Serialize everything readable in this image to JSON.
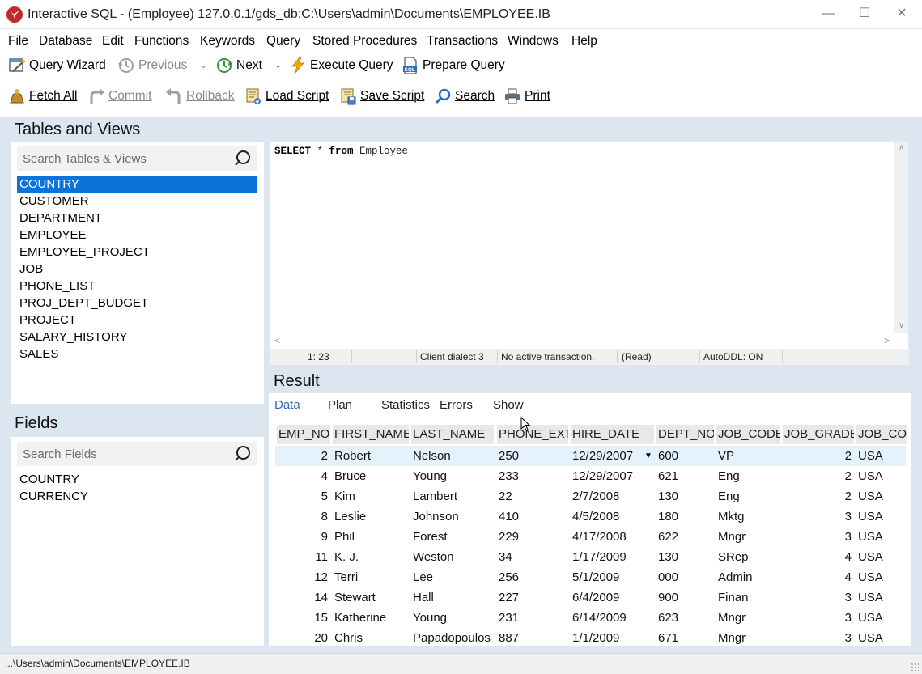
{
  "window": {
    "title": "Interactive SQL - (Employee) 127.0.0.1/gds_db:C:\\Users\\admin\\Documents\\EMPLOYEE.IB",
    "minimize_glyph": "—",
    "maximize_glyph": "☐",
    "close_glyph": "✕"
  },
  "menu": [
    "File",
    "Database",
    "Edit",
    "Functions",
    "Keywords",
    "Query",
    "Stored Procedures",
    "Transactions",
    "Windows",
    "Help"
  ],
  "toolbar1": {
    "query_wizard": "Query Wizard",
    "previous": "Previous",
    "next": "Next",
    "execute_query": "Execute Query",
    "prepare_query": "Prepare Query",
    "dropdown_glyph": "⌄"
  },
  "toolbar2": {
    "fetch_all": "Fetch All",
    "commit": "Commit",
    "rollback": "Rollback",
    "load_script": "Load Script",
    "save_script": "Save Script",
    "search": "Search",
    "print": "Print"
  },
  "tables_views": {
    "title": "Tables and Views",
    "search_placeholder": "Search Tables & Views",
    "items": [
      "COUNTRY",
      "CUSTOMER",
      "DEPARTMENT",
      "EMPLOYEE",
      "EMPLOYEE_PROJECT",
      "JOB",
      "PHONE_LIST",
      "PROJ_DEPT_BUDGET",
      "PROJECT",
      "SALARY_HISTORY",
      "SALES"
    ],
    "selected": "COUNTRY"
  },
  "fields": {
    "title": "Fields",
    "search_placeholder": "Search Fields",
    "items": [
      "COUNTRY",
      "CURRENCY"
    ]
  },
  "editor": {
    "sql_keyword1": "SELECT",
    "sql_star": " * ",
    "sql_keyword2": "from",
    "sql_table": " Employee",
    "position": "1: 23",
    "dialect": "Client dialect 3",
    "transaction": "No active transaction.",
    "mode": "(Read)",
    "autoddl": "AutoDDL: ON",
    "scroll_up": "∧",
    "scroll_down": "∨",
    "scroll_left": "<",
    "scroll_right": ">"
  },
  "result": {
    "title": "Result",
    "tabs": [
      "Data",
      "Plan",
      "Statistics",
      "Errors",
      "Show"
    ],
    "active_tab": "Data",
    "columns": [
      "EMP_NO",
      "FIRST_NAME",
      "LAST_NAME",
      "PHONE_EXT",
      "HIRE_DATE",
      "DEPT_NO",
      "JOB_CODE",
      "JOB_GRADE",
      "JOB_COUNTRY"
    ],
    "date_dropdown_glyph": "▼",
    "rows": [
      [
        "2",
        "Robert",
        "Nelson",
        "250",
        "12/29/2007",
        "600",
        "VP",
        "2",
        "USA"
      ],
      [
        "4",
        "Bruce",
        "Young",
        "233",
        "12/29/2007",
        "621",
        "Eng",
        "2",
        "USA"
      ],
      [
        "5",
        "Kim",
        "Lambert",
        "22",
        "2/7/2008",
        "130",
        "Eng",
        "2",
        "USA"
      ],
      [
        "8",
        "Leslie",
        "Johnson",
        "410",
        "4/5/2008",
        "180",
        "Mktg",
        "3",
        "USA"
      ],
      [
        "9",
        "Phil",
        "Forest",
        "229",
        "4/17/2008",
        "622",
        "Mngr",
        "3",
        "USA"
      ],
      [
        "11",
        "K. J.",
        "Weston",
        "34",
        "1/17/2009",
        "130",
        "SRep",
        "4",
        "USA"
      ],
      [
        "12",
        "Terri",
        "Lee",
        "256",
        "5/1/2009",
        "000",
        "Admin",
        "4",
        "USA"
      ],
      [
        "14",
        "Stewart",
        "Hall",
        "227",
        "6/4/2009",
        "900",
        "Finan",
        "3",
        "USA"
      ],
      [
        "15",
        "Katherine",
        "Young",
        "231",
        "6/14/2009",
        "623",
        "Mngr",
        "3",
        "USA"
      ],
      [
        "20",
        "Chris",
        "Papadopoulos",
        "887",
        "1/1/2009",
        "671",
        "Mngr",
        "3",
        "USA"
      ]
    ]
  },
  "status": {
    "path": "...\\Users\\admin\\Documents\\EMPLOYEE.IB"
  },
  "colors": {
    "selection": "#0a74da",
    "panel_bg": "#dce6f1",
    "active_tab": "#2b6cb8"
  }
}
